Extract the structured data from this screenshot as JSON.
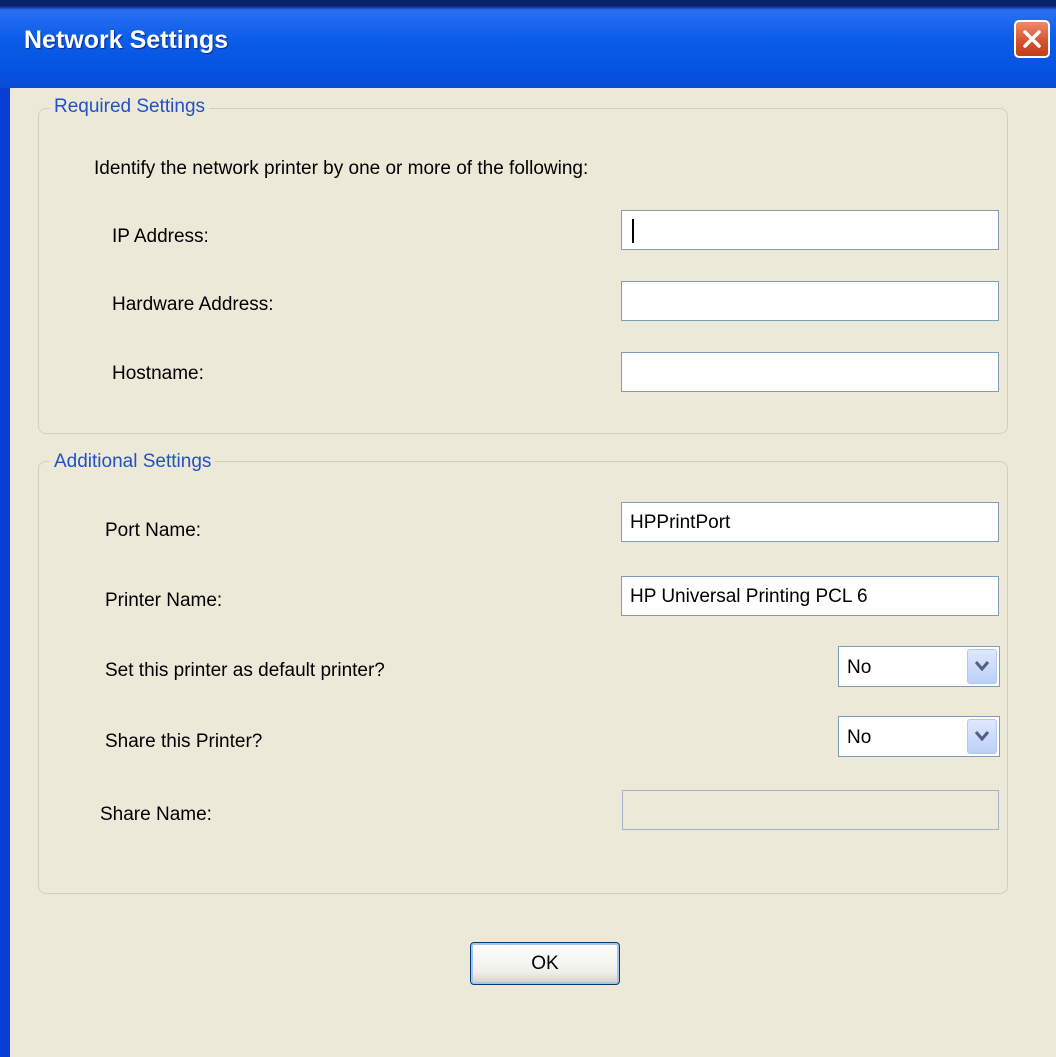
{
  "window": {
    "title": "Network Settings"
  },
  "required": {
    "legend": "Required Settings",
    "intro": "Identify the network printer by one or more of the following:",
    "ip_label": "IP Address:",
    "ip_value": "",
    "hardware_label": "Hardware Address:",
    "hardware_value": "",
    "hostname_label": "Hostname:",
    "hostname_value": ""
  },
  "additional": {
    "legend": "Additional Settings",
    "port_label": "Port Name:",
    "port_value": "HPPrintPort",
    "printer_label": "Printer Name:",
    "printer_value": "HP Universal Printing PCL 6",
    "default_label": "Set this printer as default printer?",
    "default_value": "No",
    "share_label": "Share this Printer?",
    "share_value": "No",
    "sharename_label": "Share Name:",
    "sharename_value": ""
  },
  "buttons": {
    "ok": "OK"
  },
  "icons": {
    "close": "close-icon",
    "dropdown": "chevron-down-icon"
  },
  "colors": {
    "titlebar": "#0553e2",
    "dialog_bg": "#ece9d8",
    "legend_text": "#2150c8",
    "close_button": "#d2502d"
  }
}
